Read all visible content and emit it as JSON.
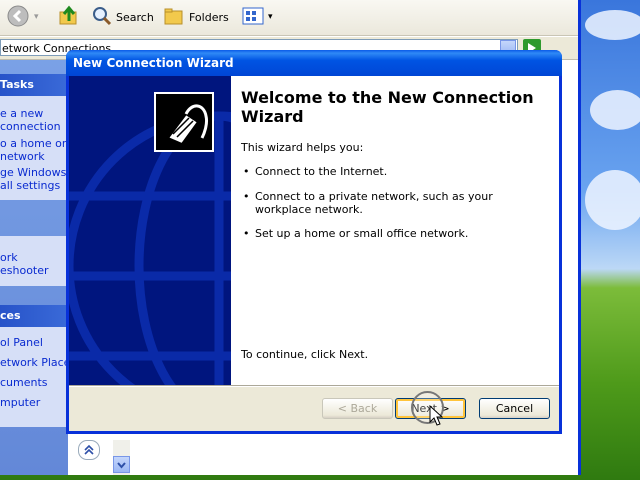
{
  "toolbar": {
    "search_label": "Search",
    "folders_label": "Folders"
  },
  "address": {
    "value": "etwork Connections"
  },
  "task_pane": {
    "network_tasks_header": "Tasks",
    "network_tasks_links": [
      "e a new",
      "connection",
      "o a home or small",
      "network",
      "ge Windows",
      "all settings"
    ],
    "see_also_links": [
      "ork",
      "eshooter"
    ],
    "other_places_header": "ces",
    "other_places_links": [
      "ol Panel",
      "etwork Places",
      "cuments",
      "mputer"
    ]
  },
  "wizard": {
    "title": "New Connection Wizard",
    "heading": "Welcome to the New Connection Wizard",
    "intro": "This wizard helps you:",
    "bullets": [
      "Connect to the Internet.",
      "Connect to a private network, such as your workplace network.",
      "Set up a home or small office network."
    ],
    "continue_text": "To continue, click Next.",
    "back_label": "< Back",
    "next_label": "Next >",
    "cancel_label": "Cancel"
  },
  "colors": {
    "titlebar": "#0054e3",
    "left_panel": "#00157e",
    "task_pane": "#6388d8",
    "link": "#0a2bd0"
  },
  "icons": [
    "back-arrow-icon",
    "up-folder-icon",
    "search-icon",
    "folders-icon",
    "views-icon",
    "go-icon",
    "network-cable-icon",
    "collapse-icon",
    "scroll-down-icon"
  ]
}
